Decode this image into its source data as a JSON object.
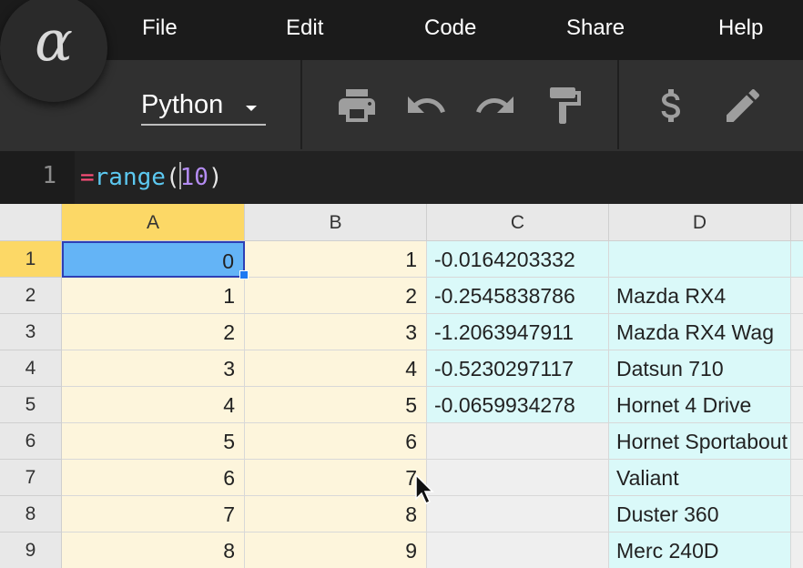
{
  "menu": {
    "file": "File",
    "edit": "Edit",
    "code": "Code",
    "share": "Share",
    "help": "Help"
  },
  "logo": {
    "glyph": "α",
    "icon": "alpha-logo-icon"
  },
  "toolbar": {
    "language": "Python",
    "icons": [
      "print-icon",
      "undo-icon",
      "redo-icon",
      "paint-roller-icon",
      "dollar-icon",
      "pencil-icon"
    ]
  },
  "formula": {
    "line_number": "1",
    "eq": "=",
    "fn": "range",
    "open": "(",
    "num_a": "1",
    "num_b": "0",
    "close": ")"
  },
  "sheet": {
    "columns": [
      "A",
      "B",
      "C",
      "D"
    ],
    "rows": [
      "1",
      "2",
      "3",
      "4",
      "5",
      "6",
      "7",
      "8",
      "9"
    ],
    "col_a": [
      "0",
      "1",
      "2",
      "3",
      "4",
      "5",
      "6",
      "7",
      "8"
    ],
    "col_b": [
      "1",
      "2",
      "3",
      "4",
      "5",
      "6",
      "7",
      "8",
      "9"
    ],
    "col_c": [
      "-0.0164203332",
      "-0.2545838786",
      "-1.2063947911",
      "-0.5230297117",
      "-0.0659934278",
      "",
      "",
      "",
      ""
    ],
    "col_d": [
      "",
      "Mazda RX4",
      "Mazda RX4 Wag",
      "Datsun 710",
      "Hornet 4 Drive",
      "Hornet Sportabout",
      "Valiant",
      "Duster 360",
      "Merc 240D"
    ],
    "selected_cell": "A1"
  },
  "colors": {
    "menubar": "#1b1b1b",
    "toolbar": "#303030",
    "selection": "#64b4f6",
    "header_selected": "#fcd866",
    "cells_yellow": "#fdf5dc",
    "cells_cyan": "#daf9f9"
  }
}
